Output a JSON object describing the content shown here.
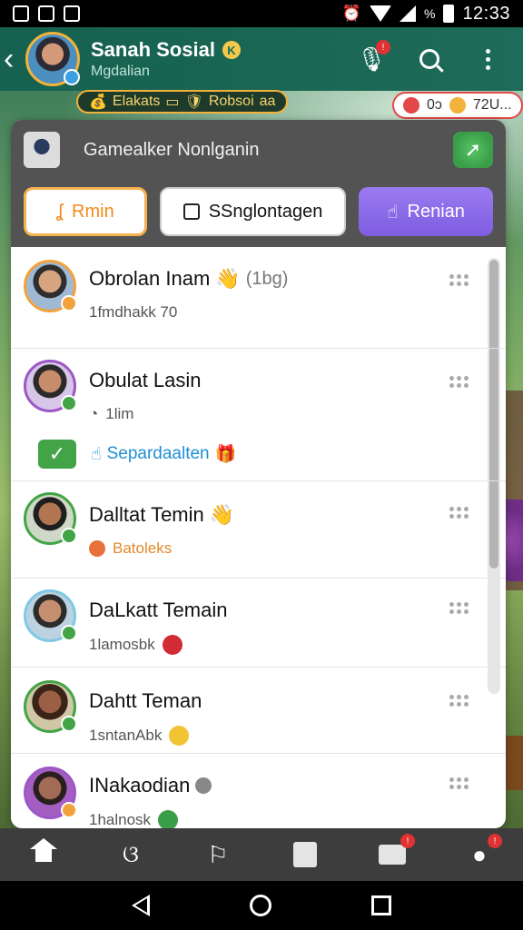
{
  "status_bar": {
    "time": "12:33",
    "battery_label": "%"
  },
  "header": {
    "name": "Sanah Sosial",
    "subtitle": "Mgdalian",
    "badge": "K"
  },
  "chips": {
    "game": "Elakats",
    "game_extra": "Robsoi",
    "game_tail": "aa",
    "stats_a": "0ɔ",
    "stats_b": "72U..."
  },
  "panel": {
    "game_title": "Gamealker Nonlganin",
    "buttons": {
      "rain": "Rmin",
      "single": "SSnglontagen",
      "renian": "Renian"
    }
  },
  "list": [
    {
      "name": "Obrolan Inam",
      "extra": "(1bg)",
      "sub": "1fmdhakk 70",
      "status_color": "#f2a23b",
      "avatar_bg": "#d6a47e"
    },
    {
      "name": "Obulat Lasin",
      "extra": "",
      "sub": "1lim",
      "status_color": "#43a447",
      "avatar_bg": "#c78c6a",
      "action": {
        "link": "Separdaalten"
      }
    },
    {
      "name": "Dalltat Temin",
      "extra": "",
      "sub": "Batoleks",
      "status_color": "#43a447",
      "avatar_bg": "#b27552"
    },
    {
      "name": "DaLkatt Temain",
      "extra": "",
      "sub": "1lamosbk",
      "status_color": "#43a447",
      "avatar_bg": "#c58f6f"
    },
    {
      "name": "Dahtt Teman",
      "extra": "",
      "sub": "1sntanAbk",
      "status_color": "#43a447",
      "avatar_bg": "#9a5f45"
    },
    {
      "name": "INakaodian",
      "extra": "",
      "sub": "1halnosk",
      "status_color": "#f2a23b",
      "avatar_bg": "#a36b55"
    }
  ],
  "bottom_nav": [
    "home",
    "friends",
    "activity",
    "notes",
    "inbox",
    "alerts"
  ],
  "notif": "!"
}
